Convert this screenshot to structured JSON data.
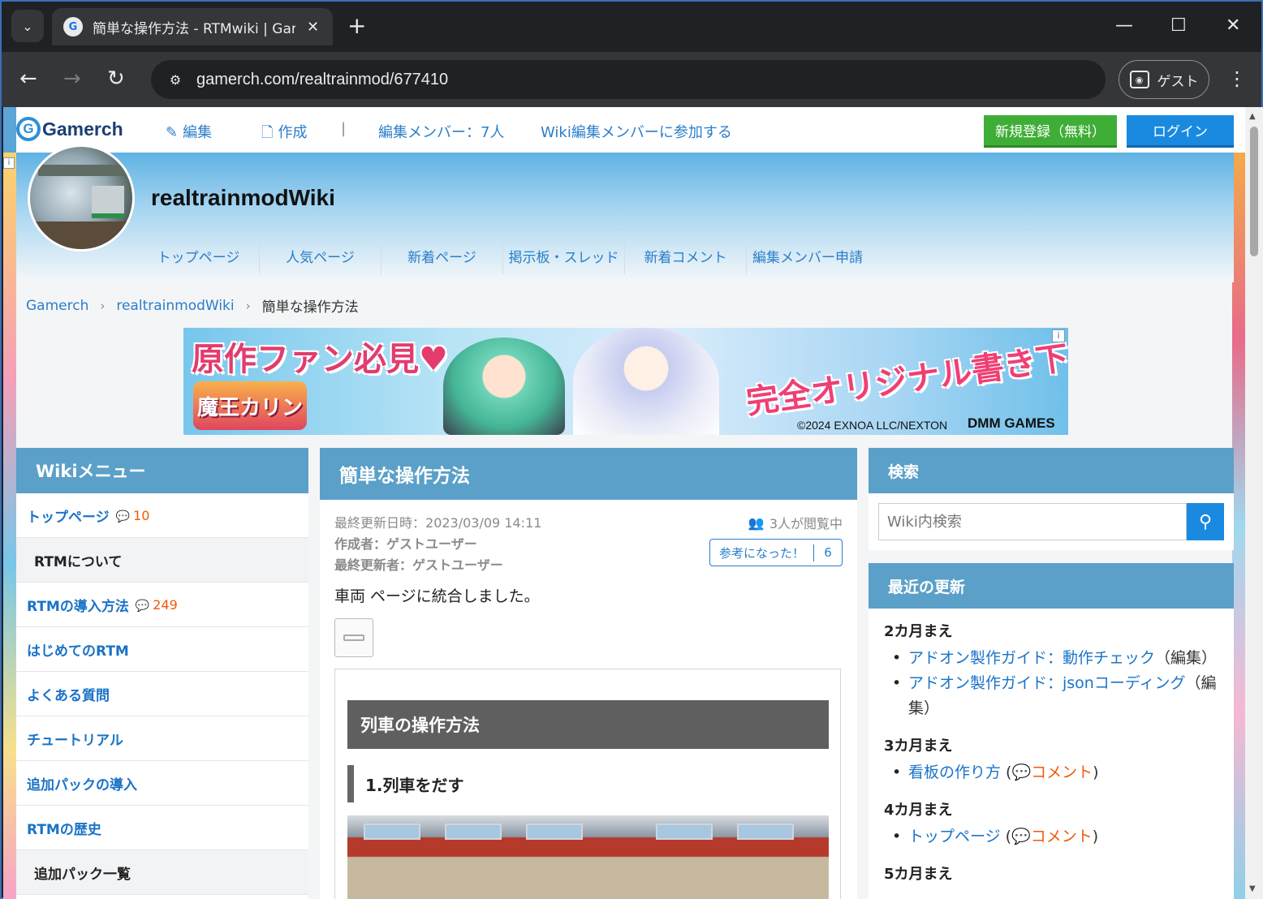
{
  "browser": {
    "tab_title": "簡単な操作方法 - RTMwiki | Gamerch",
    "url": "gamerch.com/realtrainmod/677410",
    "profile_label": "ゲスト",
    "icons": {
      "tab_menu": "chevron-down-icon",
      "close_tab": "close-icon",
      "new_tab": "plus-icon",
      "back": "arrow-left-icon",
      "forward": "arrow-right-icon",
      "reload": "reload-icon",
      "site_info": "tune-icon",
      "menu": "kebab-icon"
    }
  },
  "site": {
    "logo": "Gamerch",
    "top_links": {
      "edit": "編集",
      "create": "作成",
      "members": "編集メンバー：7人",
      "join": "Wiki編集メンバーに参加する"
    },
    "register_label": "新規登録（無料）",
    "login_label": "ログイン",
    "accent_color": "#5ba0c8"
  },
  "wiki": {
    "title": "realtrainmodWiki",
    "nav": [
      "トップページ",
      "人気ページ",
      "新着ページ",
      "掲示板・スレッド",
      "新着コメント",
      "編集メンバー申請"
    ]
  },
  "breadcrumb": [
    "Gamerch",
    "realtrainmodWiki",
    "簡単な操作方法"
  ],
  "banner": {
    "headline_left": "原作ファン必見♥",
    "game_logo": "魔王カリン",
    "headline_right": "完全オリジナル書き下ろしイラスト!",
    "copyright": "©2024 EXNOA LLC/NEXTON",
    "brand": "DMM GAMES",
    "info_icon": "i"
  },
  "left_menu": {
    "title": "Wikiメニュー",
    "items": [
      {
        "label": "トップページ",
        "type": "link",
        "comments": "10"
      },
      {
        "label": "RTMについて",
        "type": "category",
        "comments": null
      },
      {
        "label": "RTMの導入方法",
        "type": "link",
        "comments": "249"
      },
      {
        "label": "はじめてのRTM",
        "type": "link",
        "comments": null
      },
      {
        "label": "よくある質問",
        "type": "link",
        "comments": null
      },
      {
        "label": "チュートリアル",
        "type": "link",
        "comments": null
      },
      {
        "label": "追加パックの導入",
        "type": "link",
        "comments": null
      },
      {
        "label": "RTMの歴史",
        "type": "link",
        "comments": null
      },
      {
        "label": "追加パック一覧",
        "type": "category",
        "comments": null
      }
    ]
  },
  "article": {
    "title": "簡単な操作方法",
    "last_updated_label": "最終更新日時：",
    "last_updated": "2023/03/09 14:11",
    "author_label": "作成者：",
    "author": "ゲストユーザー",
    "last_editor_label": "最終更新者：",
    "last_editor": "ゲストユーザー",
    "viewing": "3人が閲覧中",
    "helpful_label": "参考になった！",
    "helpful_count": "6",
    "merged_note": "車両 ページに統合しました。",
    "h2": "列車の操作方法",
    "h3": "1.列車をだす"
  },
  "search": {
    "title": "検索",
    "placeholder": "Wiki内検索"
  },
  "recent": {
    "title": "最近の更新",
    "groups": [
      {
        "label": "2カ月まえ",
        "items": [
          {
            "link": "アドオン製作ガイド：動作チェック",
            "suffix": "（編集）",
            "comment": null
          },
          {
            "link": "アドオン製作ガイド：jsonコーディング",
            "suffix": "（編集）",
            "comment": null
          }
        ]
      },
      {
        "label": "3カ月まえ",
        "items": [
          {
            "link": "看板の作り方",
            "suffix": null,
            "comment": "コメント"
          }
        ]
      },
      {
        "label": "4カ月まえ",
        "items": [
          {
            "link": "トップページ",
            "suffix": null,
            "comment": "コメント"
          }
        ]
      },
      {
        "label": "5カ月まえ",
        "items": []
      }
    ]
  }
}
